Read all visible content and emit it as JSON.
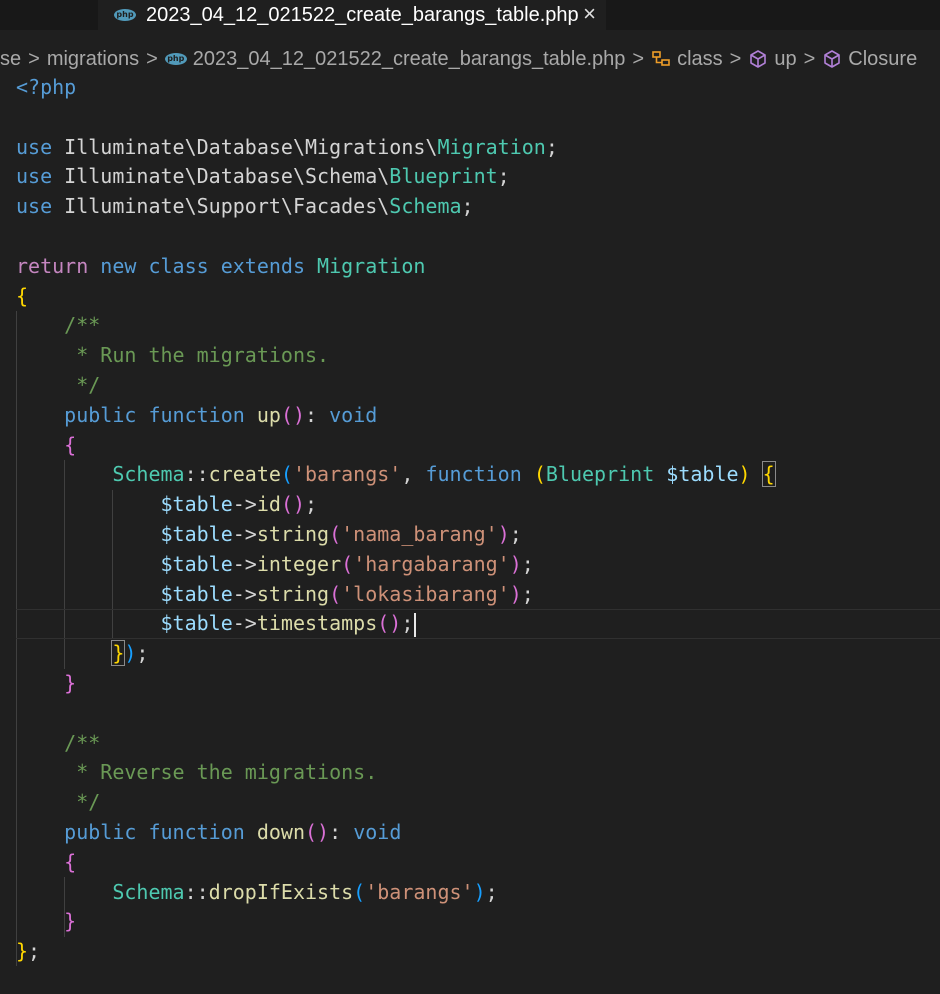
{
  "tab": {
    "title": "2023_04_12_021522_create_barangs_table.php",
    "close": "×",
    "icon": "php-file-icon",
    "icon_text": "php"
  },
  "breadcrumb": {
    "items": [
      "se",
      "migrations",
      "2023_04_12_021522_create_barangs_table.php",
      "class",
      "up",
      "Closure"
    ],
    "separator": ">"
  },
  "code": {
    "lines": [
      [
        [
          "kw",
          "<?php"
        ]
      ],
      [],
      [
        [
          "kw",
          "use "
        ],
        [
          "ns",
          "Illuminate\\Database\\Migrations\\"
        ],
        [
          "typ",
          "Migration"
        ],
        [
          "ns",
          ";"
        ]
      ],
      [
        [
          "kw",
          "use "
        ],
        [
          "ns",
          "Illuminate\\Database\\Schema\\"
        ],
        [
          "typ",
          "Blueprint"
        ],
        [
          "ns",
          ";"
        ]
      ],
      [
        [
          "kw",
          "use "
        ],
        [
          "ns",
          "Illuminate\\Support\\Facades\\"
        ],
        [
          "typ",
          "Schema"
        ],
        [
          "ns",
          ";"
        ]
      ],
      [],
      [
        [
          "ctl",
          "return "
        ],
        [
          "kw",
          "new "
        ],
        [
          "kw",
          "class "
        ],
        [
          "kw",
          "extends "
        ],
        [
          "typ",
          "Migration"
        ]
      ],
      [
        [
          "b1",
          "{"
        ]
      ],
      [
        [
          "ns",
          "    "
        ],
        [
          "cmt",
          "/**"
        ]
      ],
      [
        [
          "ns",
          "     "
        ],
        [
          "cmt",
          "* Run the migrations."
        ]
      ],
      [
        [
          "ns",
          "     "
        ],
        [
          "cmt",
          "*/"
        ]
      ],
      [
        [
          "ns",
          "    "
        ],
        [
          "kw",
          "public "
        ],
        [
          "kw",
          "function "
        ],
        [
          "fn",
          "up"
        ],
        [
          "b2",
          "()"
        ],
        [
          "ns",
          ": "
        ],
        [
          "kw",
          "void"
        ]
      ],
      [
        [
          "ns",
          "    "
        ],
        [
          "b2",
          "{"
        ]
      ],
      [
        [
          "ns",
          "        "
        ],
        [
          "typ",
          "Schema"
        ],
        [
          "ns",
          "::"
        ],
        [
          "fn",
          "create"
        ],
        [
          "b3",
          "("
        ],
        [
          "str",
          "'barangs'"
        ],
        [
          "ns",
          ", "
        ],
        [
          "kw",
          "function "
        ],
        [
          "b1",
          "("
        ],
        [
          "typ",
          "Blueprint "
        ],
        [
          "var",
          "$table"
        ],
        [
          "b1",
          ")"
        ],
        [
          "ns",
          " "
        ],
        [
          "b1 bm",
          "{"
        ]
      ],
      [
        [
          "ns",
          "            "
        ],
        [
          "var",
          "$table"
        ],
        [
          "ns",
          "->"
        ],
        [
          "fn",
          "id"
        ],
        [
          "b2",
          "()"
        ],
        [
          "ns",
          ";"
        ]
      ],
      [
        [
          "ns",
          "            "
        ],
        [
          "var",
          "$table"
        ],
        [
          "ns",
          "->"
        ],
        [
          "fn",
          "string"
        ],
        [
          "b2",
          "("
        ],
        [
          "str",
          "'nama_barang'"
        ],
        [
          "b2",
          ")"
        ],
        [
          "ns",
          ";"
        ]
      ],
      [
        [
          "ns",
          "            "
        ],
        [
          "var",
          "$table"
        ],
        [
          "ns",
          "->"
        ],
        [
          "fn",
          "integer"
        ],
        [
          "b2",
          "("
        ],
        [
          "str",
          "'hargabarang'"
        ],
        [
          "b2",
          ")"
        ],
        [
          "ns",
          ";"
        ]
      ],
      [
        [
          "ns",
          "            "
        ],
        [
          "var",
          "$table"
        ],
        [
          "ns",
          "->"
        ],
        [
          "fn",
          "string"
        ],
        [
          "b2",
          "("
        ],
        [
          "str",
          "'lokasibarang'"
        ],
        [
          "b2",
          ")"
        ],
        [
          "ns",
          ";"
        ]
      ],
      [
        [
          "ns",
          "            "
        ],
        [
          "var",
          "$table"
        ],
        [
          "ns",
          "->"
        ],
        [
          "fn",
          "timestamps"
        ],
        [
          "b2",
          "()"
        ],
        [
          "ns",
          ";"
        ]
      ],
      [
        [
          "ns",
          "        "
        ],
        [
          "b1 bm",
          "}"
        ],
        [
          "b3",
          ")"
        ],
        [
          "ns",
          ";"
        ]
      ],
      [
        [
          "ns",
          "    "
        ],
        [
          "b2",
          "}"
        ]
      ],
      [],
      [
        [
          "ns",
          "    "
        ],
        [
          "cmt",
          "/**"
        ]
      ],
      [
        [
          "ns",
          "     "
        ],
        [
          "cmt",
          "* Reverse the migrations."
        ]
      ],
      [
        [
          "ns",
          "     "
        ],
        [
          "cmt",
          "*/"
        ]
      ],
      [
        [
          "ns",
          "    "
        ],
        [
          "kw",
          "public "
        ],
        [
          "kw",
          "function "
        ],
        [
          "fn",
          "down"
        ],
        [
          "b2",
          "()"
        ],
        [
          "ns",
          ": "
        ],
        [
          "kw",
          "void"
        ]
      ],
      [
        [
          "ns",
          "    "
        ],
        [
          "b2",
          "{"
        ]
      ],
      [
        [
          "ns",
          "        "
        ],
        [
          "typ",
          "Schema"
        ],
        [
          "ns",
          "::"
        ],
        [
          "fn",
          "dropIfExists"
        ],
        [
          "b3",
          "("
        ],
        [
          "str",
          "'barangs'"
        ],
        [
          "b3",
          ")"
        ],
        [
          "ns",
          ";"
        ]
      ],
      [
        [
          "ns",
          "    "
        ],
        [
          "b2",
          "}"
        ]
      ],
      [
        [
          "b1",
          "}"
        ],
        [
          "ns",
          ";"
        ]
      ]
    ],
    "current_line": 18
  },
  "colors": {
    "background": "#1f1f1f",
    "keyword": "#569cd6",
    "control": "#c586c0",
    "type": "#4ec9b0",
    "function": "#dcdcaa",
    "string": "#ce9178",
    "variable": "#9cdcfe",
    "comment": "#6a9955"
  },
  "icons": {
    "class_icon": "class-symbol-icon",
    "method_icon": "method-cube-icon",
    "closure_icon": "closure-cube-icon"
  }
}
